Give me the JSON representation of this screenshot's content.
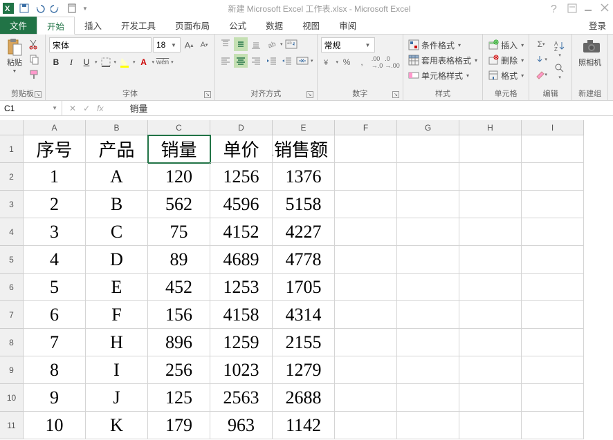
{
  "titlebar": {
    "title": "新建 Microsoft Excel 工作表.xlsx - Microsoft Excel"
  },
  "tabs": {
    "file": "文件",
    "home": "开始",
    "insert": "插入",
    "dev": "开发工具",
    "layout": "页面布局",
    "formulas": "公式",
    "data": "数据",
    "view": "视图",
    "review": "审阅",
    "login": "登录"
  },
  "ribbon": {
    "clipboard": {
      "paste": "粘贴",
      "label": "剪贴板"
    },
    "font": {
      "name": "宋体",
      "size": "18",
      "ruby": "wén",
      "label": "字体"
    },
    "align": {
      "label": "对齐方式"
    },
    "number": {
      "format": "常规",
      "label": "数字"
    },
    "styles": {
      "cond": "条件格式",
      "table": "套用表格格式",
      "cell": "单元格样式",
      "label": "样式"
    },
    "cells": {
      "insert": "插入",
      "delete": "删除",
      "format": "格式",
      "label": "单元格"
    },
    "editing": {
      "label": "编辑"
    },
    "camera": {
      "btn": "照相机",
      "label": "新建组"
    }
  },
  "namebox": {
    "ref": "C1",
    "fx": "销量"
  },
  "columns": [
    "A",
    "B",
    "C",
    "D",
    "E",
    "F",
    "G",
    "H",
    "I"
  ],
  "rows": [
    "1",
    "2",
    "3",
    "4",
    "5",
    "6",
    "7",
    "8",
    "9",
    "10",
    "11"
  ],
  "headers": [
    "序号",
    "产品",
    "销量",
    "单价",
    "总销售额"
  ],
  "data": [
    [
      "1",
      "A",
      "120",
      "1256",
      "1376"
    ],
    [
      "2",
      "B",
      "562",
      "4596",
      "5158"
    ],
    [
      "3",
      "C",
      "75",
      "4152",
      "4227"
    ],
    [
      "4",
      "D",
      "89",
      "4689",
      "4778"
    ],
    [
      "5",
      "E",
      "452",
      "1253",
      "1705"
    ],
    [
      "6",
      "F",
      "156",
      "4158",
      "4314"
    ],
    [
      "7",
      "H",
      "896",
      "1259",
      "2155"
    ],
    [
      "8",
      "I",
      "256",
      "1023",
      "1279"
    ],
    [
      "9",
      "J",
      "125",
      "2563",
      "2688"
    ],
    [
      "10",
      "K",
      "179",
      "963",
      "1142"
    ]
  ]
}
